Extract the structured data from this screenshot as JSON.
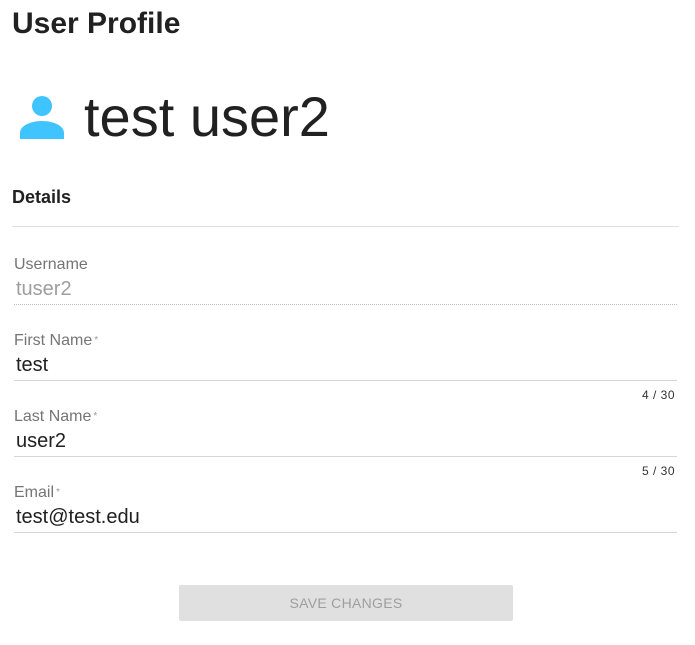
{
  "page": {
    "title": "User Profile"
  },
  "profile": {
    "display_name": "test user2",
    "avatar_icon": "account-circle-icon",
    "avatar_color": "#40C4FF"
  },
  "details": {
    "section_title": "Details",
    "fields": [
      {
        "label": "Username",
        "value": "tuser2",
        "required": false,
        "readonly": true
      },
      {
        "label": "First Name",
        "value": "test",
        "required": true,
        "required_marker": "*",
        "counter": "4 / 30"
      },
      {
        "label": "Last Name",
        "value": "user2",
        "required": true,
        "required_marker": "*",
        "counter": "5 / 30"
      },
      {
        "label": "Email",
        "value": "test@test.edu",
        "required": true,
        "required_marker": "*"
      }
    ]
  },
  "actions": {
    "save_label": "SAVE CHANGES",
    "save_disabled": true
  }
}
